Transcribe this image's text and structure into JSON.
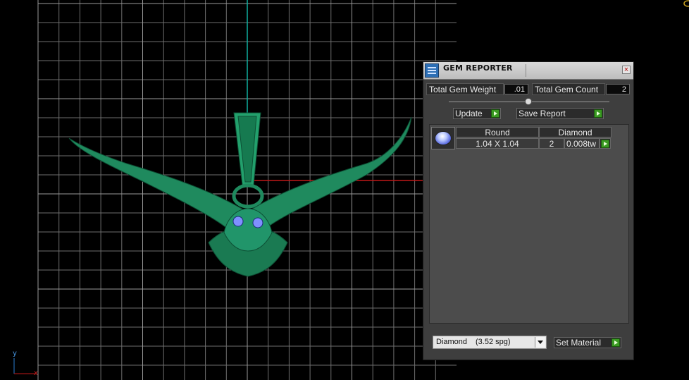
{
  "viewport": {
    "axis_y_label": "y",
    "axis_x_label": "x",
    "colors": {
      "grid": "#6e6e6e",
      "y_axis": "#0fb0a0",
      "x_axis": "#c01818",
      "model": "#1f8a5e"
    }
  },
  "panel": {
    "title": "GEM REPORTER",
    "close_label": "×",
    "total_weight_label": "Total Gem Weight",
    "total_weight_value": ".01",
    "total_count_label": "Total Gem Count",
    "total_count_value": "2",
    "update_label": "Update",
    "save_report_label": "Save Report",
    "gem_table": {
      "header": {
        "shape": "Round",
        "material": "Diamond"
      },
      "rows": [
        {
          "size": "1.04 X 1.04",
          "count": "2",
          "weight": "0.008tw"
        }
      ]
    },
    "material_select": {
      "name": "Diamond",
      "spg": "(3.52 spg)"
    },
    "set_material_label": "Set Material",
    "colors": {
      "panel_bg": "#3e3e3e",
      "go_button": "#3a9a22",
      "gem_icon": "#5a6be0"
    }
  }
}
